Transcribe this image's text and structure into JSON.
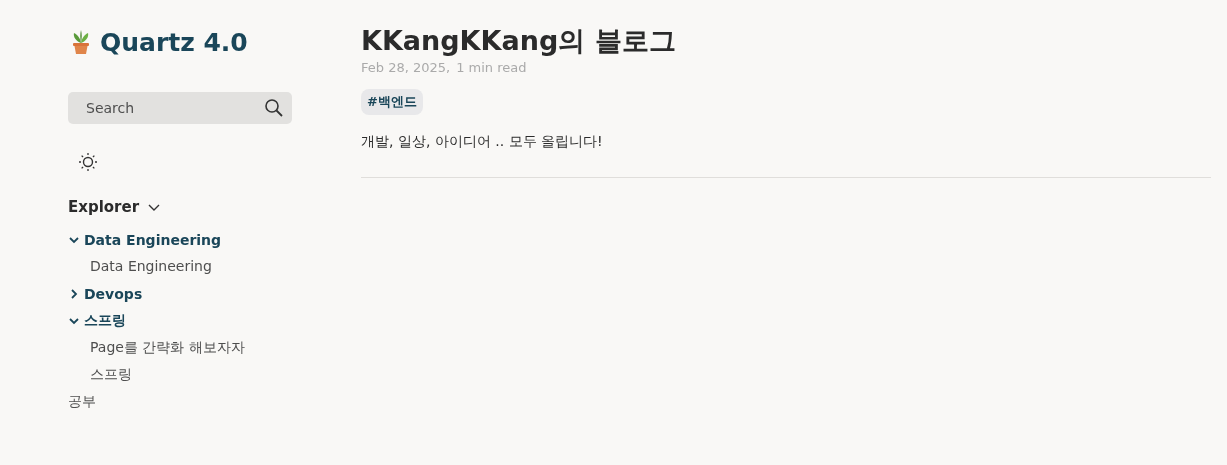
{
  "site_title": "Quartz 4.0",
  "search": {
    "placeholder": "Search"
  },
  "explorer": {
    "title": "Explorer",
    "expanded": true,
    "items": [
      {
        "kind": "folder",
        "label": "Data Engineering",
        "expanded": true,
        "children": [
          {
            "kind": "file",
            "label": "Data Engineering"
          }
        ]
      },
      {
        "kind": "folder",
        "label": "Devops",
        "expanded": false
      },
      {
        "kind": "folder",
        "label": "스프링",
        "expanded": true,
        "children": [
          {
            "kind": "file",
            "label": "Page를 간략화 해보자자"
          },
          {
            "kind": "file",
            "label": "스프링"
          }
        ]
      },
      {
        "kind": "file",
        "label": "공부"
      }
    ]
  },
  "article": {
    "title": "KKangKKang의 블로그",
    "date": "Feb 28, 2025,",
    "reading_time": "1 min read",
    "tags": [
      "#백엔드"
    ],
    "body": "개발, 일상, 아이디어 .. 모두 올립니다!"
  }
}
